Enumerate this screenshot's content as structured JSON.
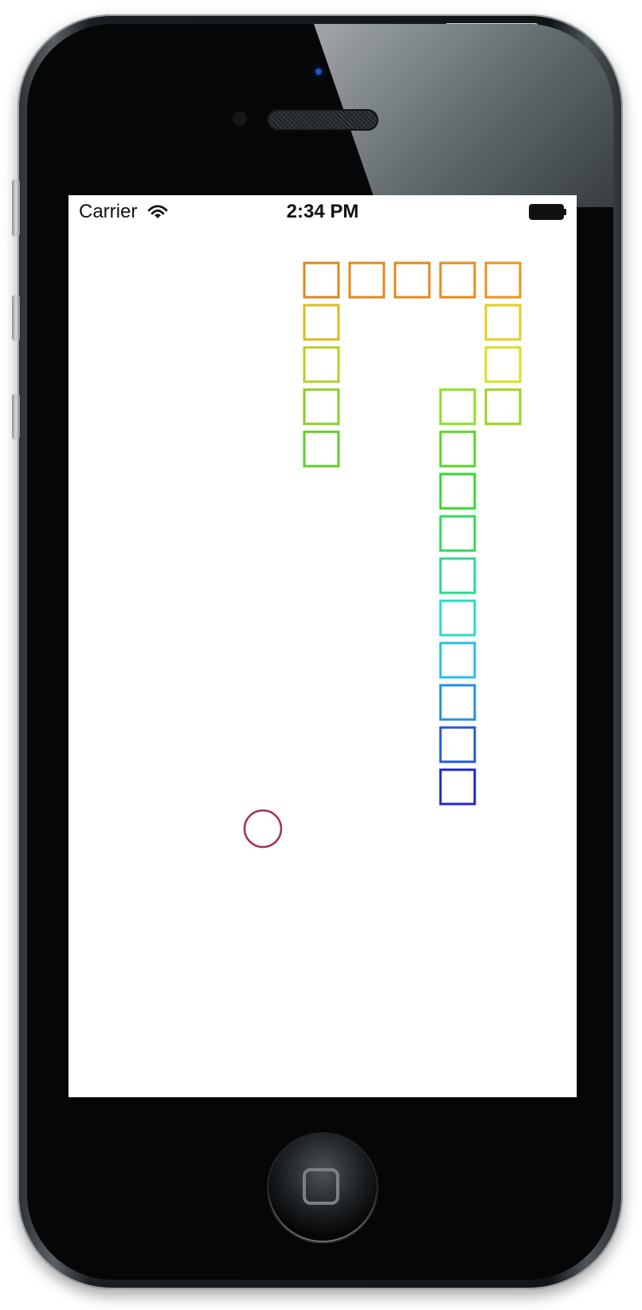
{
  "status_bar": {
    "carrier": "Carrier",
    "time": "2:34 PM"
  },
  "icons": {
    "wifi": "wifi-icon",
    "battery": "battery-icon",
    "home": "home-button"
  },
  "game": {
    "snake_segments": [
      {
        "color": "#d88a1d"
      },
      {
        "color": "#de8a1d"
      },
      {
        "color": "#e08a1d"
      },
      {
        "color": "#e48b1d"
      },
      {
        "color": "#e7951d"
      },
      {
        "color": "#e4cd1d"
      },
      {
        "color": "#d7e11d"
      },
      {
        "color": "#9bd31d"
      },
      {
        "color": "#89df24"
      },
      {
        "color": "#58d428"
      },
      {
        "color": "#34d82d"
      },
      {
        "color": "#31d958"
      },
      {
        "color": "#2bd890"
      },
      {
        "color": "#2cd9cc"
      },
      {
        "color": "#29bee1"
      },
      {
        "color": "#268ee0"
      },
      {
        "color": "#2358d5"
      },
      {
        "color": "#1e27c8"
      },
      {
        "color": "#dabc1f"
      },
      {
        "color": "#b6cf23"
      },
      {
        "color": "#89cd26"
      },
      {
        "color": "#5fcd2e"
      }
    ],
    "food_color": "#a52f4f"
  }
}
